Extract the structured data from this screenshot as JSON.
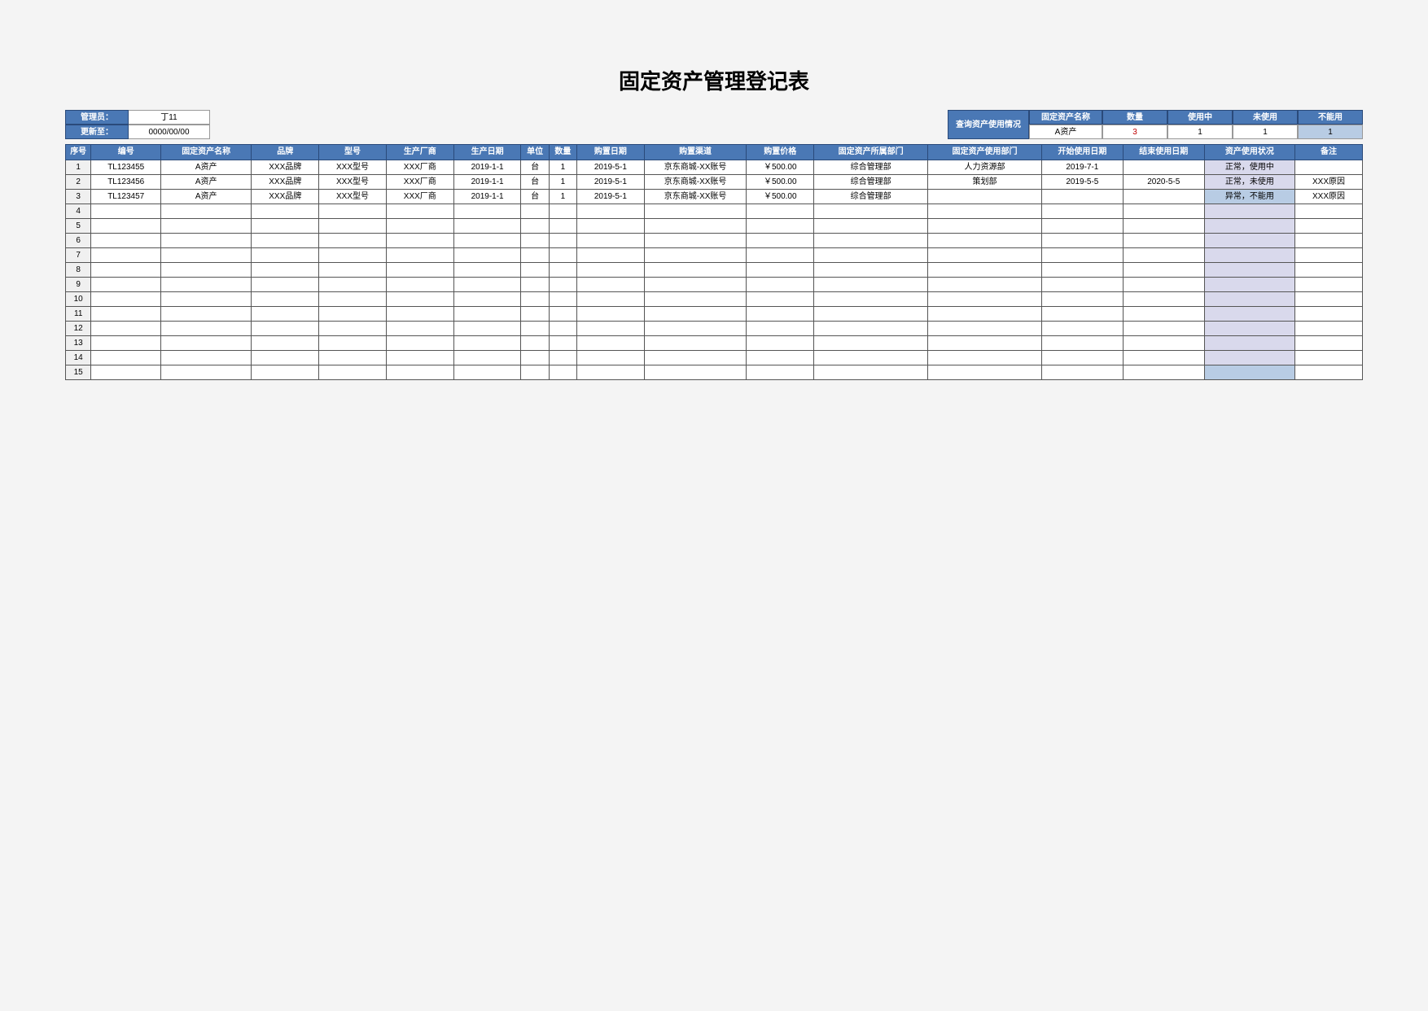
{
  "title": "固定资产管理登记表",
  "meta": {
    "admin_label": "管理员：",
    "admin_value": "丁11",
    "update_label": "更新至：",
    "update_value": "0000/00/00"
  },
  "query": {
    "label": "查询资产使用情况",
    "headers": [
      "固定资产名称",
      "数量",
      "使用中",
      "未使用",
      "不能用"
    ],
    "values": [
      "A资产",
      "3",
      "1",
      "1",
      "1"
    ]
  },
  "table": {
    "headers": [
      "序号",
      "编号",
      "固定资产名称",
      "品牌",
      "型号",
      "生产厂商",
      "生产日期",
      "单位",
      "数量",
      "购置日期",
      "购置渠道",
      "购置价格",
      "固定资产所属部门",
      "固定资产使用部门",
      "开始使用日期",
      "结束使用日期",
      "资产使用状况",
      "备注"
    ],
    "rows": [
      {
        "n": "1",
        "cells": [
          "TL123455",
          "A资产",
          "XXX品牌",
          "XXX型号",
          "XXX厂商",
          "2019-1-1",
          "台",
          "1",
          "2019-5-1",
          "京东商城-XX账号",
          "￥500.00",
          "综合管理部",
          "人力资源部",
          "2019-7-1",
          "",
          "正常，使用中",
          ""
        ],
        "statusClass": "status-pale"
      },
      {
        "n": "2",
        "cells": [
          "TL123456",
          "A资产",
          "XXX品牌",
          "XXX型号",
          "XXX厂商",
          "2019-1-1",
          "台",
          "1",
          "2019-5-1",
          "京东商城-XX账号",
          "￥500.00",
          "综合管理部",
          "策划部",
          "2019-5-5",
          "2020-5-5",
          "正常，未使用",
          "XXX原因"
        ],
        "statusClass": "status-pale"
      },
      {
        "n": "3",
        "cells": [
          "TL123457",
          "A资产",
          "XXX品牌",
          "XXX型号",
          "XXX厂商",
          "2019-1-1",
          "台",
          "1",
          "2019-5-1",
          "京东商城-XX账号",
          "￥500.00",
          "综合管理部",
          "",
          "",
          "",
          "异常，不能用",
          "XXX原因"
        ],
        "statusClass": "status-blue"
      },
      {
        "n": "4",
        "cells": [
          "",
          "",
          "",
          "",
          "",
          "",
          "",
          "",
          "",
          "",
          "",
          "",
          "",
          "",
          "",
          "",
          ""
        ],
        "statusClass": "status-pale"
      },
      {
        "n": "5",
        "cells": [
          "",
          "",
          "",
          "",
          "",
          "",
          "",
          "",
          "",
          "",
          "",
          "",
          "",
          "",
          "",
          "",
          ""
        ],
        "statusClass": "status-pale"
      },
      {
        "n": "6",
        "cells": [
          "",
          "",
          "",
          "",
          "",
          "",
          "",
          "",
          "",
          "",
          "",
          "",
          "",
          "",
          "",
          "",
          ""
        ],
        "statusClass": "status-pale"
      },
      {
        "n": "7",
        "cells": [
          "",
          "",
          "",
          "",
          "",
          "",
          "",
          "",
          "",
          "",
          "",
          "",
          "",
          "",
          "",
          "",
          ""
        ],
        "statusClass": "status-pale"
      },
      {
        "n": "8",
        "cells": [
          "",
          "",
          "",
          "",
          "",
          "",
          "",
          "",
          "",
          "",
          "",
          "",
          "",
          "",
          "",
          "",
          ""
        ],
        "statusClass": "status-pale"
      },
      {
        "n": "9",
        "cells": [
          "",
          "",
          "",
          "",
          "",
          "",
          "",
          "",
          "",
          "",
          "",
          "",
          "",
          "",
          "",
          "",
          ""
        ],
        "statusClass": "status-pale"
      },
      {
        "n": "10",
        "cells": [
          "",
          "",
          "",
          "",
          "",
          "",
          "",
          "",
          "",
          "",
          "",
          "",
          "",
          "",
          "",
          "",
          ""
        ],
        "statusClass": "status-pale"
      },
      {
        "n": "11",
        "cells": [
          "",
          "",
          "",
          "",
          "",
          "",
          "",
          "",
          "",
          "",
          "",
          "",
          "",
          "",
          "",
          "",
          ""
        ],
        "statusClass": "status-pale"
      },
      {
        "n": "12",
        "cells": [
          "",
          "",
          "",
          "",
          "",
          "",
          "",
          "",
          "",
          "",
          "",
          "",
          "",
          "",
          "",
          "",
          ""
        ],
        "statusClass": "status-pale"
      },
      {
        "n": "13",
        "cells": [
          "",
          "",
          "",
          "",
          "",
          "",
          "",
          "",
          "",
          "",
          "",
          "",
          "",
          "",
          "",
          "",
          ""
        ],
        "statusClass": "status-pale"
      },
      {
        "n": "14",
        "cells": [
          "",
          "",
          "",
          "",
          "",
          "",
          "",
          "",
          "",
          "",
          "",
          "",
          "",
          "",
          "",
          "",
          ""
        ],
        "statusClass": "status-pale"
      },
      {
        "n": "15",
        "cells": [
          "",
          "",
          "",
          "",
          "",
          "",
          "",
          "",
          "",
          "",
          "",
          "",
          "",
          "",
          "",
          "",
          ""
        ],
        "statusClass": "status-blue"
      }
    ]
  }
}
